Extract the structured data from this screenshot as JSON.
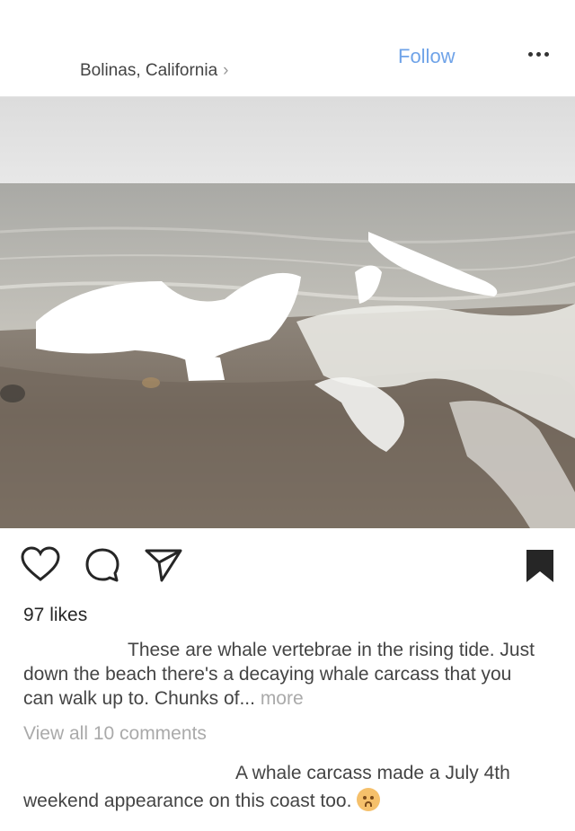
{
  "header": {
    "location": "Bolinas, California",
    "location_chevron": "›",
    "follow_label": "Follow",
    "more_icon": "more-dots-icon"
  },
  "post": {
    "image_alt": "Beach with waves washing over whale vertebrae",
    "icons": [
      "heart-icon",
      "comment-icon",
      "share-icon",
      "bookmark-icon"
    ],
    "likes": "97 likes",
    "caption": "These are whale vertebrae in the rising tide. Just down the beach there's a decaying whale carcass that you can walk up to. Chunks of...",
    "caption_more": "more",
    "view_all_comments": "View all 10 comments",
    "comment": "A whale carcass made a July 4th weekend appearance on this coast too."
  },
  "colors": {
    "accent": "#6fa3e8",
    "muted": "#aaaaaa"
  }
}
